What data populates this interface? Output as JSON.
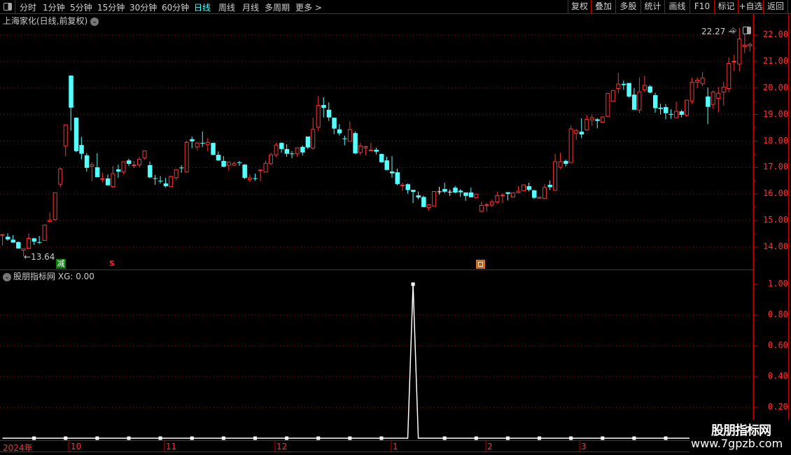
{
  "toolbar": {
    "periods": [
      "分时",
      "1分钟",
      "5分钟",
      "15分钟",
      "30分钟",
      "60分钟",
      "日线",
      "周线",
      "月线",
      "多周期",
      "更多 >"
    ],
    "active_period": "日线",
    "buttons": [
      "复权",
      "叠加",
      "多股",
      "统计",
      "画线",
      "F10",
      "标记",
      "+自选",
      "返回"
    ]
  },
  "main": {
    "title": "上海家化(日线,前复权)",
    "price_ticks": [
      "22.00",
      "21.00",
      "20.00",
      "19.00",
      "18.00",
      "17.00",
      "16.00",
      "15.00",
      "14.00"
    ],
    "high_label": "22.27",
    "low_label": "13.64",
    "signals": {
      "reduce": "减",
      "sell": "S"
    },
    "colors": {
      "up": "#ff3232",
      "down": "#54ffff",
      "flat": "#ffffff",
      "grid": "#c00000"
    },
    "candles_ohlc": [
      [
        14.45,
        14.49,
        14.06,
        14.47
      ],
      [
        14.39,
        14.52,
        14.24,
        14.29
      ],
      [
        14.28,
        14.45,
        14.17,
        14.17
      ],
      [
        14.19,
        14.22,
        13.95,
        13.95
      ],
      [
        13.88,
        13.95,
        13.64,
        13.94
      ],
      [
        13.96,
        14.52,
        13.94,
        14.33
      ],
      [
        14.33,
        14.35,
        14.09,
        14.21
      ],
      [
        14.19,
        14.42,
        14.12,
        14.17
      ],
      [
        14.25,
        14.84,
        14.24,
        14.83
      ],
      [
        14.96,
        15.31,
        14.96,
        15.01
      ],
      [
        15.04,
        16.06,
        15.0,
        16.05
      ],
      [
        16.37,
        17.0,
        16.26,
        16.95
      ],
      [
        17.82,
        18.62,
        17.42,
        18.61
      ],
      [
        20.47,
        20.47,
        18.39,
        19.26
      ],
      [
        18.88,
        18.88,
        17.58,
        17.62
      ],
      [
        17.85,
        18.16,
        17.31,
        17.52
      ],
      [
        17.46,
        17.55,
        16.85,
        16.99
      ],
      [
        17.05,
        17.19,
        16.49,
        17.11
      ],
      [
        17.01,
        17.54,
        16.64,
        16.64
      ],
      [
        16.56,
        16.8,
        16.44,
        16.58
      ],
      [
        16.59,
        16.74,
        16.33,
        16.33
      ],
      [
        16.28,
        17.06,
        16.23,
        16.77
      ],
      [
        16.93,
        17.11,
        16.61,
        16.85
      ],
      [
        16.83,
        17.24,
        16.76,
        17.22
      ],
      [
        17.27,
        17.33,
        17.06,
        17.14
      ],
      [
        17.08,
        17.25,
        16.98,
        17.1
      ],
      [
        17.1,
        17.4,
        17.01,
        17.31
      ],
      [
        17.36,
        17.64,
        17.31,
        17.63
      ],
      [
        17.09,
        17.22,
        16.6,
        16.63
      ],
      [
        16.6,
        16.72,
        16.35,
        16.58
      ],
      [
        16.5,
        16.68,
        16.4,
        16.49
      ],
      [
        16.4,
        16.61,
        16.25,
        16.3
      ],
      [
        16.28,
        16.7,
        16.28,
        16.66
      ],
      [
        16.62,
        16.93,
        16.52,
        16.92
      ],
      [
        17.0,
        17.09,
        16.8,
        16.99
      ],
      [
        16.83,
        18.01,
        16.83,
        17.95
      ],
      [
        18.07,
        18.17,
        17.73,
        17.99
      ],
      [
        17.78,
        17.95,
        17.65,
        17.93
      ],
      [
        17.93,
        18.36,
        17.77,
        17.9
      ],
      [
        17.86,
        18.12,
        17.62,
        17.95
      ],
      [
        17.93,
        17.93,
        17.46,
        17.48
      ],
      [
        17.48,
        17.61,
        17.25,
        17.27
      ],
      [
        17.25,
        17.43,
        17.02,
        17.03
      ],
      [
        17.09,
        17.21,
        16.88,
        17.21
      ],
      [
        17.09,
        17.23,
        17.07,
        17.16
      ],
      [
        17.2,
        17.25,
        17.06,
        17.19
      ],
      [
        17.11,
        17.13,
        16.56,
        16.61
      ],
      [
        16.54,
        16.74,
        16.45,
        16.61
      ],
      [
        16.6,
        16.77,
        16.51,
        16.59
      ],
      [
        16.89,
        16.91,
        16.48,
        16.91
      ],
      [
        16.83,
        17.26,
        16.83,
        17.16
      ],
      [
        17.15,
        17.56,
        17.09,
        17.48
      ],
      [
        17.48,
        17.93,
        17.39,
        17.85
      ],
      [
        17.93,
        17.95,
        17.56,
        17.7
      ],
      [
        17.7,
        17.88,
        17.41,
        17.52
      ],
      [
        17.53,
        17.62,
        17.35,
        17.52
      ],
      [
        17.52,
        17.74,
        17.41,
        17.74
      ],
      [
        17.78,
        17.83,
        17.46,
        17.57
      ],
      [
        18.17,
        18.17,
        17.7,
        17.76
      ],
      [
        17.73,
        18.88,
        17.68,
        18.44
      ],
      [
        18.52,
        19.7,
        18.37,
        19.35
      ],
      [
        19.36,
        19.65,
        18.89,
        19.25
      ],
      [
        19.18,
        19.46,
        18.76,
        18.89
      ],
      [
        18.88,
        18.88,
        18.26,
        18.47
      ],
      [
        18.44,
        18.64,
        18.21,
        18.29
      ],
      [
        18.1,
        18.2,
        17.84,
        18.08
      ],
      [
        17.99,
        18.74,
        17.99,
        18.43
      ],
      [
        18.3,
        18.37,
        17.51,
        17.54
      ],
      [
        17.57,
        17.93,
        17.46,
        17.82
      ],
      [
        17.74,
        17.83,
        17.46,
        17.79
      ],
      [
        17.64,
        17.93,
        17.6,
        17.66
      ],
      [
        17.67,
        17.75,
        17.49,
        17.6
      ],
      [
        17.51,
        17.53,
        17.18,
        17.2
      ],
      [
        17.27,
        17.41,
        16.91,
        16.91
      ],
      [
        16.85,
        17.43,
        16.62,
        16.78
      ],
      [
        16.82,
        16.96,
        16.33,
        16.38
      ],
      [
        16.32,
        16.43,
        16.12,
        16.34
      ],
      [
        16.37,
        16.4,
        16.02,
        16.15
      ],
      [
        16.16,
        16.16,
        15.66,
        16.08
      ],
      [
        15.95,
        16.1,
        15.8,
        15.87
      ],
      [
        15.89,
        15.94,
        15.51,
        15.51
      ],
      [
        15.49,
        15.6,
        15.38,
        15.6
      ],
      [
        15.55,
        16.1,
        15.55,
        16.1
      ],
      [
        16.1,
        16.27,
        15.98,
        16.1
      ],
      [
        16.19,
        16.43,
        16.03,
        16.09
      ],
      [
        16.09,
        16.17,
        15.93,
        16.09
      ],
      [
        16.24,
        16.31,
        16.03,
        16.06
      ],
      [
        16.13,
        16.19,
        15.9,
        16.07
      ],
      [
        16.06,
        16.06,
        15.75,
        15.93
      ],
      [
        16.06,
        16.24,
        15.88,
        15.88
      ],
      [
        15.86,
        16.02,
        15.86,
        16.0
      ],
      [
        15.35,
        15.71,
        15.3,
        15.57
      ],
      [
        15.58,
        15.66,
        15.35,
        15.6
      ],
      [
        15.59,
        15.79,
        15.51,
        15.71
      ],
      [
        15.7,
        16.08,
        15.65,
        15.94
      ],
      [
        15.95,
        16.03,
        15.66,
        15.96
      ],
      [
        16.07,
        16.07,
        15.76,
        16.01
      ],
      [
        15.89,
        16.05,
        15.87,
        16.05
      ],
      [
        16.05,
        16.3,
        16.05,
        16.11
      ],
      [
        16.13,
        16.35,
        16.11,
        16.35
      ],
      [
        16.3,
        16.43,
        16.1,
        16.16
      ],
      [
        16.14,
        16.17,
        15.82,
        15.86
      ],
      [
        15.84,
        15.89,
        15.82,
        15.89
      ],
      [
        15.83,
        16.38,
        15.81,
        16.25
      ],
      [
        16.35,
        16.51,
        16.15,
        16.26
      ],
      [
        16.14,
        17.51,
        16.14,
        17.22
      ],
      [
        17.01,
        17.56,
        16.95,
        17.22
      ],
      [
        17.25,
        17.3,
        17.04,
        17.14
      ],
      [
        17.19,
        18.59,
        17.19,
        18.46
      ],
      [
        18.3,
        18.46,
        18.04,
        18.39
      ],
      [
        18.35,
        18.86,
        18.11,
        18.25
      ],
      [
        18.42,
        18.99,
        18.39,
        18.82
      ],
      [
        18.8,
        19.01,
        18.58,
        18.88
      ],
      [
        18.82,
        18.87,
        18.48,
        18.76
      ],
      [
        18.71,
        18.93,
        18.69,
        18.91
      ],
      [
        18.93,
        19.8,
        18.93,
        19.8
      ],
      [
        19.5,
        19.91,
        19.48,
        19.91
      ],
      [
        19.98,
        20.57,
        19.8,
        20.15
      ],
      [
        20.16,
        20.28,
        19.93,
        20.11
      ],
      [
        20.19,
        20.19,
        19.64,
        19.68
      ],
      [
        19.75,
        20.0,
        19.18,
        19.18
      ],
      [
        19.17,
        20.39,
        19.05,
        19.86
      ],
      [
        19.93,
        20.46,
        19.84,
        20.1
      ],
      [
        20.06,
        20.11,
        19.8,
        19.83
      ],
      [
        19.73,
        19.82,
        19.07,
        19.24
      ],
      [
        19.26,
        19.41,
        19.0,
        19.21
      ],
      [
        19.28,
        19.39,
        18.82,
        19.05
      ],
      [
        19.02,
        19.2,
        18.84,
        19.0
      ],
      [
        18.88,
        19.49,
        18.88,
        19.12
      ],
      [
        19.12,
        19.18,
        18.89,
        18.99
      ],
      [
        18.97,
        19.54,
        18.91,
        19.54
      ],
      [
        19.51,
        20.39,
        19.4,
        20.22
      ],
      [
        20.22,
        20.41,
        20.0,
        20.3
      ],
      [
        20.16,
        20.6,
        20.07,
        20.38
      ],
      [
        19.68,
        20.02,
        18.64,
        19.29
      ],
      [
        19.38,
        19.91,
        19.23,
        19.85
      ],
      [
        19.61,
        20.04,
        19.08,
        19.8
      ],
      [
        19.85,
        20.23,
        19.34,
        20.04
      ],
      [
        19.98,
        21.16,
        19.84,
        20.93
      ],
      [
        20.99,
        21.25,
        20.63,
        21.01
      ],
      [
        20.9,
        22.27,
        20.63,
        21.85
      ],
      [
        21.56,
        22.04,
        21.32,
        21.62
      ],
      [
        21.59,
        21.71,
        21.38,
        21.65
      ]
    ]
  },
  "indicator": {
    "name": "股朋指标网",
    "readout": "XG: 0.00",
    "ticks": [
      "1.00",
      "0.80",
      "0.60",
      "0.40",
      "0.20"
    ],
    "spike_index": 78,
    "xg_value_at_spike": 1.0
  },
  "date_axis": [
    "2024年",
    "10",
    "11",
    "12",
    "1",
    "2",
    "3"
  ],
  "watermark": {
    "name": "股朋指标网",
    "url": "www.7gpzb.com"
  }
}
